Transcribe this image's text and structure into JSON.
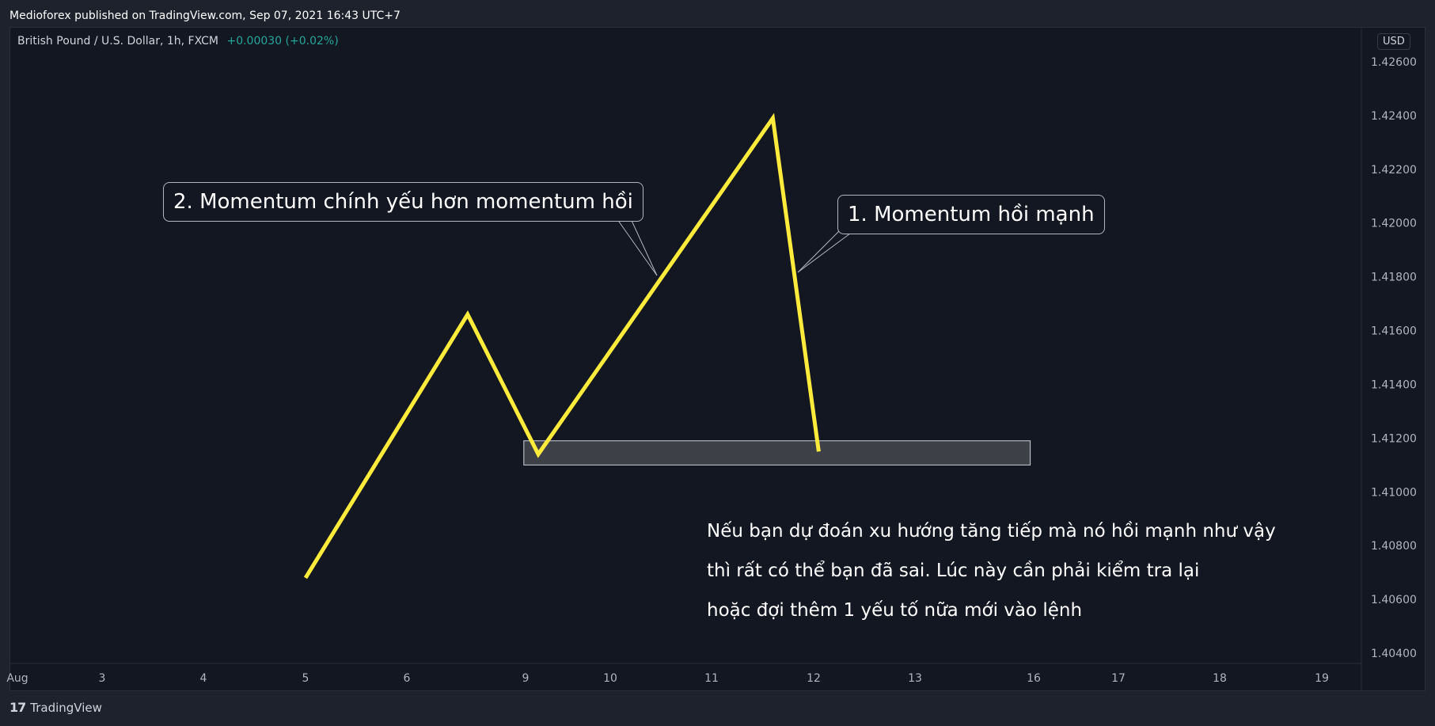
{
  "header": {
    "published_text": "Medioforex published on TradingView.com, Sep 07, 2021 16:43 UTC+7"
  },
  "symbol": {
    "name": "British Pound / U.S. Dollar, 1h, FXCM",
    "change": "+0.00030 (+0.02%)"
  },
  "currency": "USD",
  "chart_data": {
    "type": "line",
    "x_ticks": [
      "Aug",
      "3",
      "4",
      "5",
      "6",
      "9",
      "10",
      "11",
      "12",
      "13",
      "16",
      "17",
      "18",
      "19"
    ],
    "y_ticks": [
      "1.42600",
      "1.42400",
      "1.42200",
      "1.42000",
      "1.41800",
      "1.41600",
      "1.41400",
      "1.41200",
      "1.41000",
      "1.40800",
      "1.40600",
      "1.40400"
    ],
    "ylim": [
      1.404,
      1.426
    ],
    "series": [
      {
        "points": [
          {
            "x": "5",
            "y": 1.4068
          },
          {
            "x": "6.6",
            "y": 1.4166
          },
          {
            "x": "9.15",
            "y": 1.4114
          },
          {
            "x": "11.6",
            "y": 1.4239
          },
          {
            "x": "12.05",
            "y": 1.4115
          }
        ]
      }
    ],
    "zone": {
      "x_start": "8.8",
      "x_end": "15.6",
      "y_low": 1.411,
      "y_high": 1.4119
    },
    "line_color": "#ffeb3b",
    "background": "#131722"
  },
  "callouts": {
    "first": "1. Momentum hồi mạnh",
    "second": "2. Momentum chính yếu hơn momentum hồi"
  },
  "note": {
    "line1": "Nếu bạn dự đoán xu hướng tăng tiếp mà nó hồi mạnh như vậy",
    "line2": "thì rất có thể bạn đã sai. Lúc này cần phải kiểm tra lại",
    "line3": "hoặc đợi thêm 1 yếu tố nữa mới vào lệnh"
  },
  "footer": {
    "logo": "TradingView"
  }
}
